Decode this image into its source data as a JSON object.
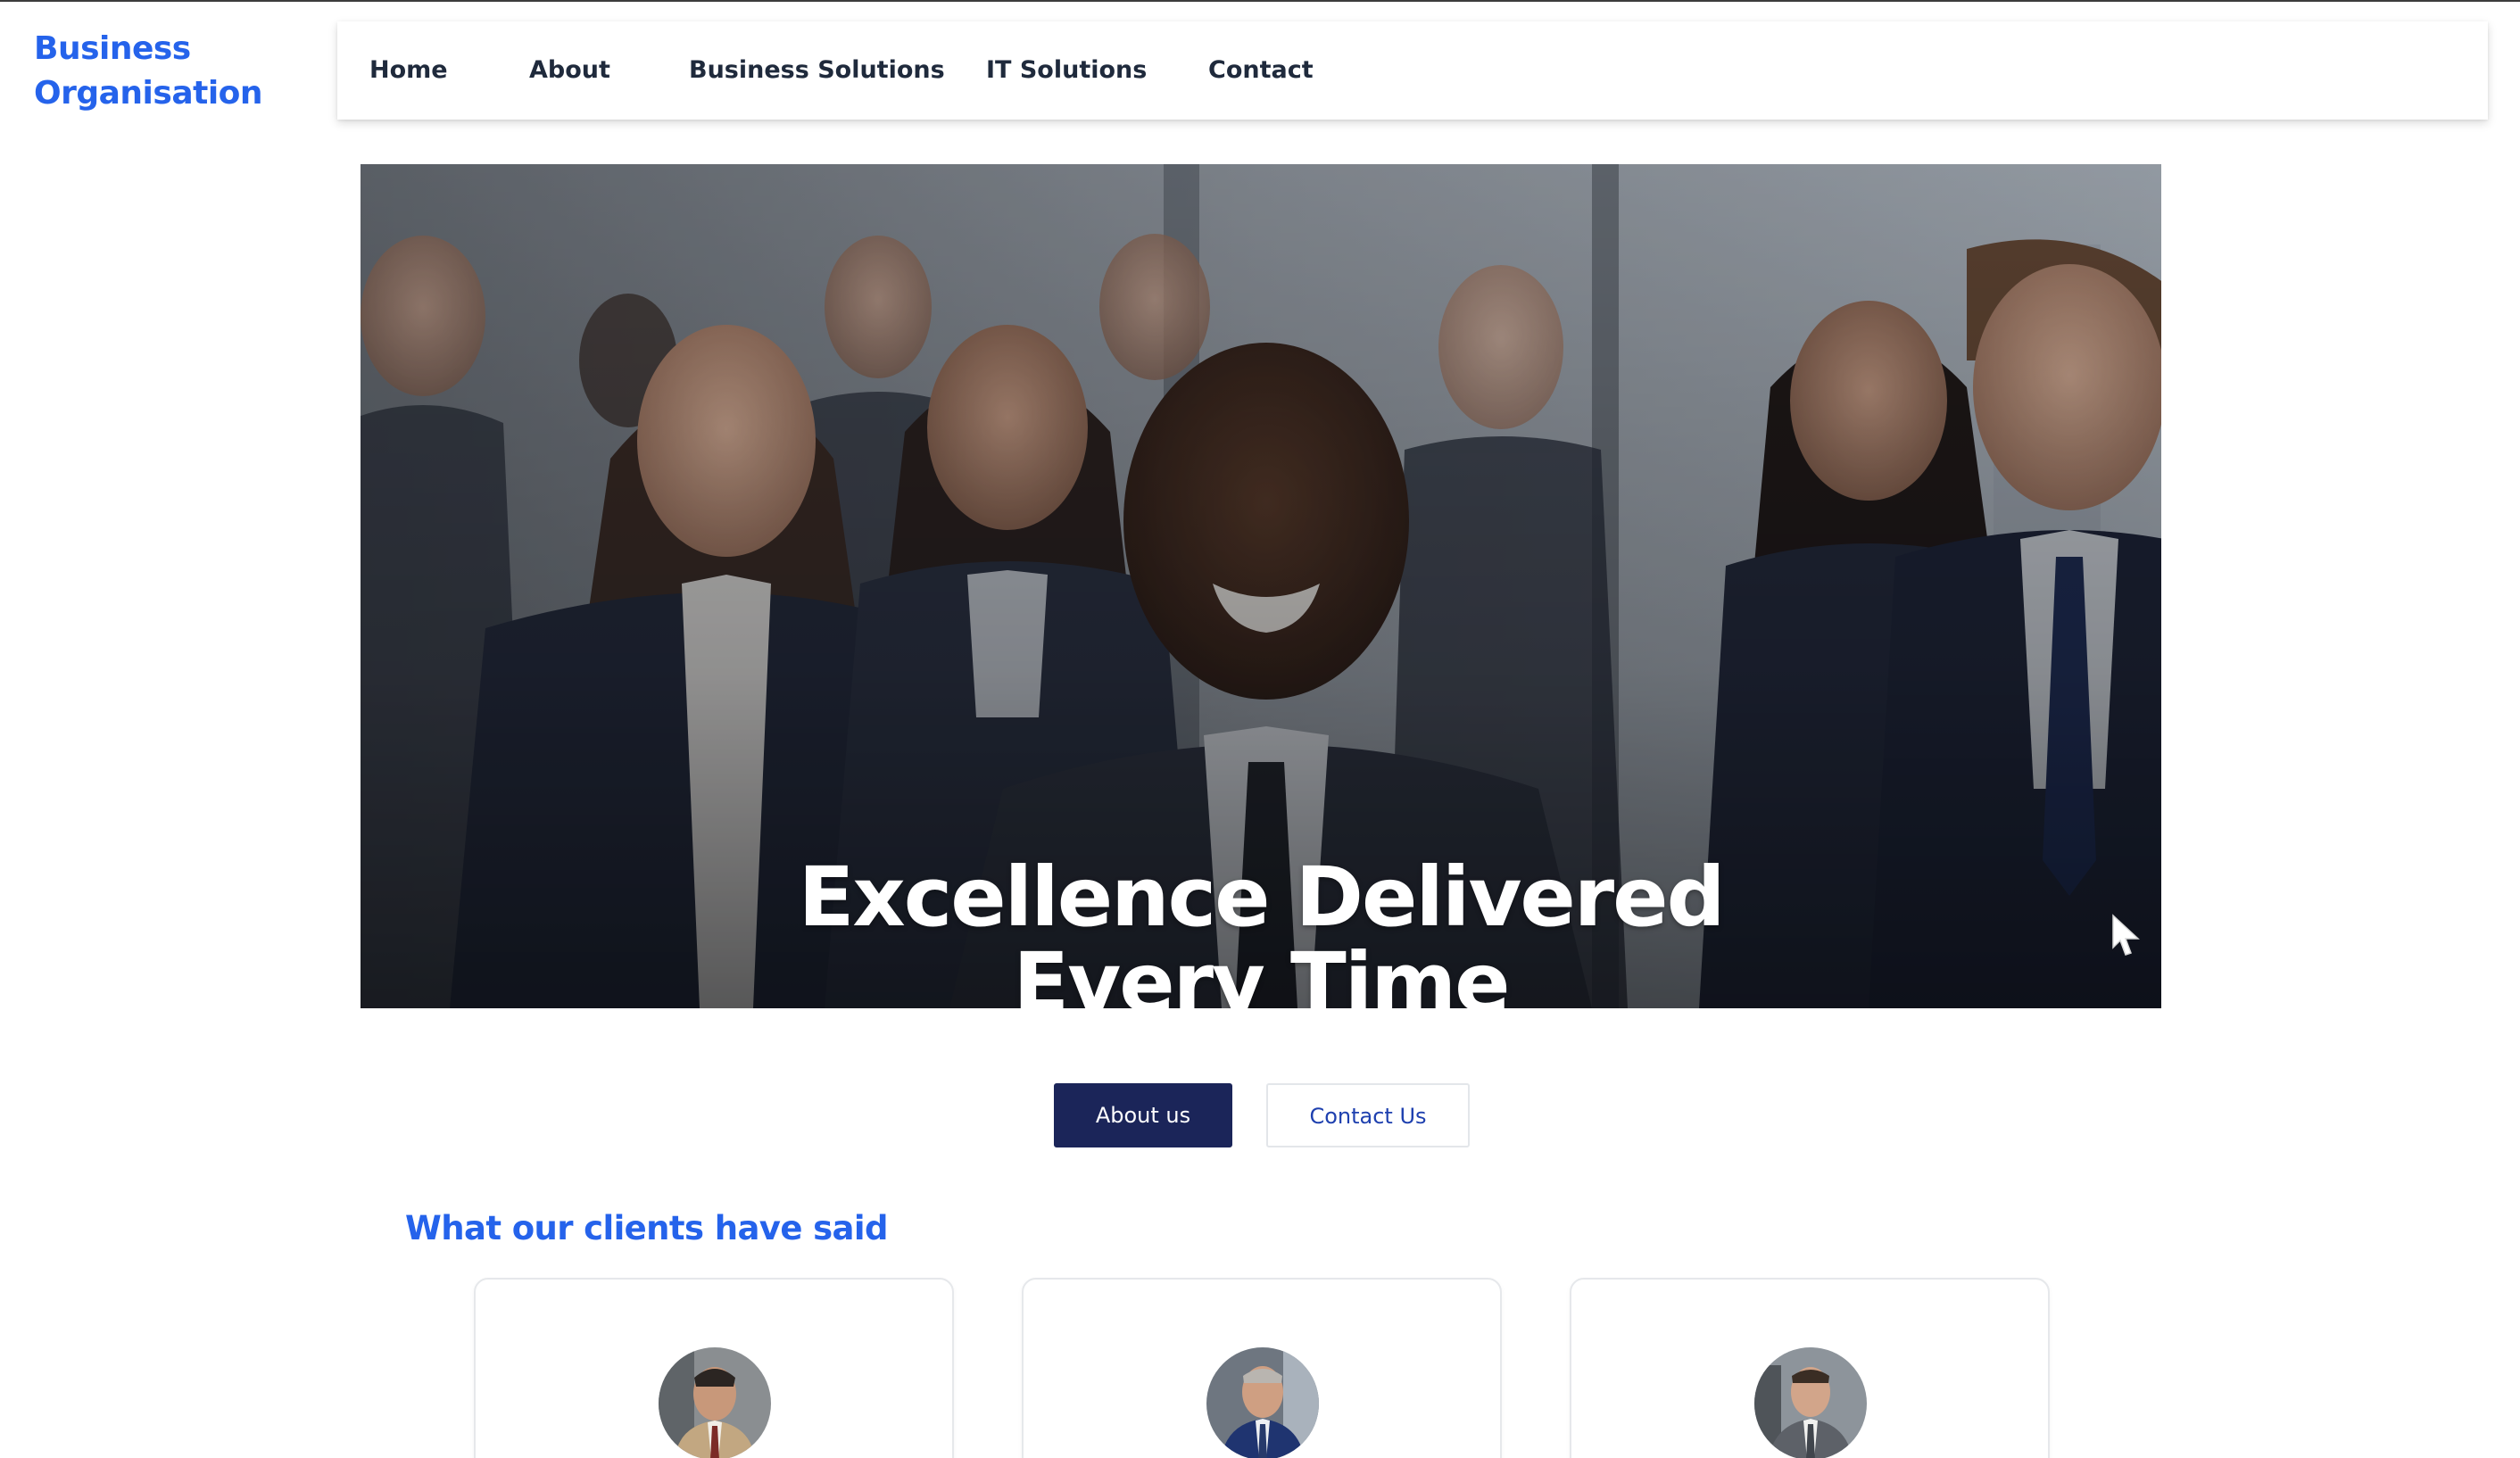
{
  "brand": {
    "line1": "Business",
    "line2": "Organisation",
    "color": "#2563eb"
  },
  "nav": {
    "items": [
      {
        "label": "Home"
      },
      {
        "label": "About"
      },
      {
        "label": "Business Solutions"
      },
      {
        "label": "IT Solutions"
      },
      {
        "label": "Contact"
      }
    ]
  },
  "hero": {
    "title_line1": "Excellence Delivered",
    "title_line2": "Every Time",
    "image": "team-of-business-professionals-photo"
  },
  "actions": {
    "about_label": "About us",
    "contact_label": "Contact Us",
    "primary_color": "#1b2559"
  },
  "testimonials": {
    "title": "What our clients have said",
    "cards": [
      {
        "avatar": "client-portrait-tan-suit"
      },
      {
        "avatar": "client-portrait-navy-suit"
      },
      {
        "avatar": "client-portrait-gray-suit"
      }
    ]
  },
  "icons": {
    "cursor": "mouse-pointer-icon"
  }
}
